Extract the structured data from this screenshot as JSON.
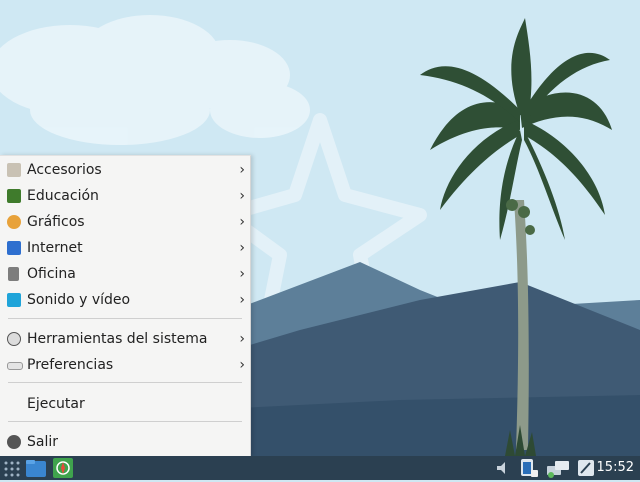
{
  "menu": {
    "items": [
      {
        "label": "Accesorios",
        "icon": "accessories-icon",
        "submenu": true
      },
      {
        "label": "Educación",
        "icon": "education-icon",
        "submenu": true
      },
      {
        "label": "Gráficos",
        "icon": "graphics-icon",
        "submenu": true
      },
      {
        "label": "Internet",
        "icon": "internet-icon",
        "submenu": true
      },
      {
        "label": "Oficina",
        "icon": "office-icon",
        "submenu": true
      },
      {
        "label": "Sonido y vídeo",
        "icon": "sound-video-icon",
        "submenu": true
      },
      {
        "label": "Herramientas del sistema",
        "icon": "system-tools-icon",
        "submenu": true
      },
      {
        "label": "Preferencias",
        "icon": "preferences-icon",
        "submenu": true
      },
      {
        "label": "Ejecutar",
        "icon": "",
        "submenu": false
      },
      {
        "label": "Salir",
        "icon": "logout-icon",
        "submenu": false
      }
    ],
    "arrow_glyph": "›"
  },
  "taskbar": {
    "clock": "15:52",
    "launchers": [
      "app-menu-icon",
      "file-manager-icon",
      "web-browser-icon"
    ],
    "tray": [
      "volume-icon",
      "battery-icon",
      "network-icon",
      "screenshot-icon"
    ]
  },
  "colors": {
    "sky": "#cfe8f3",
    "mountain_far": "#5d7f99",
    "mountain_near": "#3b5570",
    "taskbar": "#2b4051",
    "menu_bg": "#f5f5f4"
  }
}
